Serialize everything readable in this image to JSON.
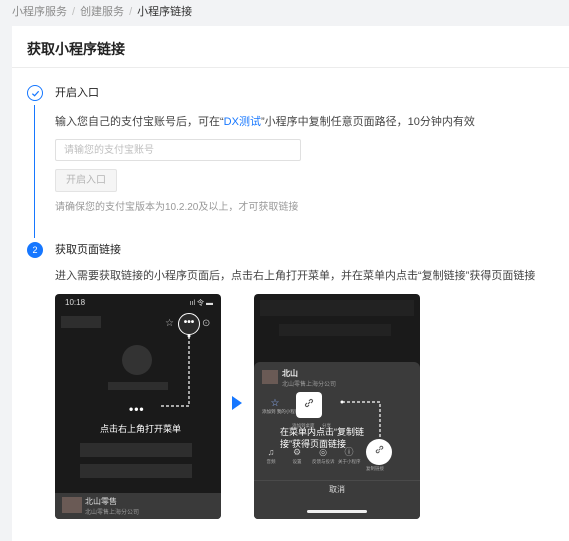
{
  "breadcrumb": [
    "小程序服务",
    "创建服务",
    "小程序链接"
  ],
  "breadcrumb_sep": "/",
  "page_title": "获取小程序链接",
  "step1": {
    "title": "开启入口",
    "desc_prefix": "输入您自己的支付宝账号后，可在“",
    "desc_link": "DX测试",
    "desc_suffix": "”小程序中复制任意页面路径，10分钟内有效",
    "input_placeholder": "请输您的支付宝账号",
    "button_label": "开启入口",
    "hint": "请确保您的支付宝版本为10.2.20及以上，才可获取链接"
  },
  "step2": {
    "number": "2",
    "title": "获取页面链接",
    "desc": "进入需要获取链接的小程序页面后，点击右上角打开菜单，并在菜单内点击“复制链接”获得页面链接"
  },
  "phone1": {
    "time": "10:18",
    "status_icons": "ııl 令 ▬",
    "capsule": "•••",
    "dots": "•••",
    "label": "点击右上角打开菜单",
    "shop_name": "北山零售",
    "shop_sub": "北山零售上海分公司"
  },
  "phone2": {
    "shop_name": "北山",
    "shop_sub": "北山零售上海分公司",
    "fav_label": "添加到\n我的小程序",
    "tiny_labels": [
      "添加到桌面",
      "分享"
    ],
    "sheet_icons": [
      "音频",
      "设置",
      "反馈与投诉",
      "关于小程序",
      "复制链接"
    ],
    "label": "在菜单内点击“复制链接”获得页面链接",
    "cancel": "取消"
  }
}
